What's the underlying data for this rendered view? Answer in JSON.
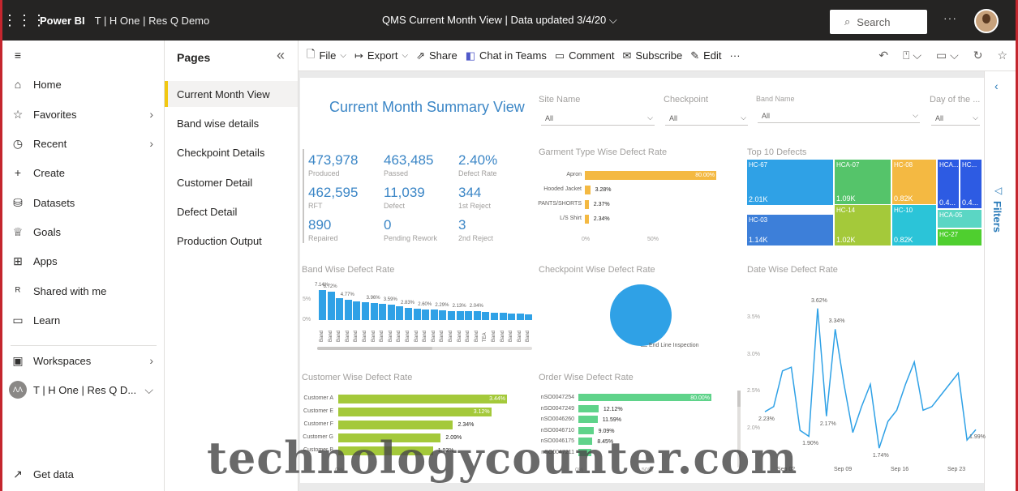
{
  "topbar": {
    "app_name": "Power BI",
    "workspace": "T | H One | Res Q Demo",
    "report_title": "QMS Current Month View  |  Data updated 3/4/20",
    "search_placeholder": "Search",
    "more": "···"
  },
  "nav": {
    "items": [
      {
        "label": "Home",
        "icon": "home-icon"
      },
      {
        "label": "Favorites",
        "icon": "star-icon"
      },
      {
        "label": "Recent",
        "icon": "clock-icon"
      },
      {
        "label": "Create",
        "icon": "plus-icon"
      },
      {
        "label": "Datasets",
        "icon": "database-icon"
      },
      {
        "label": "Goals",
        "icon": "trophy-icon"
      },
      {
        "label": "Apps",
        "icon": "apps-icon"
      },
      {
        "label": "Shared with me",
        "icon": "shared-icon"
      },
      {
        "label": "Learn",
        "icon": "book-icon"
      },
      {
        "label": "Workspaces",
        "icon": "workspaces-icon"
      },
      {
        "label": "T | H One | Res Q D...",
        "icon": "workspace-avatar-icon"
      },
      {
        "label": "Get data",
        "icon": "arrow-icon"
      }
    ]
  },
  "pages": {
    "title": "Pages",
    "items": [
      "Current Month View",
      "Band wise details",
      "Checkpoint Details",
      "Customer Detail",
      "Defect Detail",
      "Production Output"
    ]
  },
  "actionbar": {
    "file": "File",
    "export": "Export",
    "share": "Share",
    "chat": "Chat in Teams",
    "comment": "Comment",
    "subscribe": "Subscribe",
    "edit": "Edit",
    "more": "···"
  },
  "filters": {
    "label": "Filters"
  },
  "report": {
    "title": "Current Month Summary View",
    "slicers": [
      {
        "label": "Site Name",
        "value": "All"
      },
      {
        "label": "Checkpoint",
        "value": "All"
      },
      {
        "label": "Band Name",
        "value": "All"
      },
      {
        "label": "Day of the ...",
        "value": "All"
      }
    ],
    "kpis": [
      {
        "value": "473,978",
        "label": "Produced"
      },
      {
        "value": "463,485",
        "label": "Passed"
      },
      {
        "value": "2.40%",
        "label": "Defect Rate"
      },
      {
        "value": "462,595",
        "label": "RFT"
      },
      {
        "value": "11,039",
        "label": "Defect"
      },
      {
        "value": "344",
        "label": "1st Reject"
      },
      {
        "value": "890",
        "label": "Repaired"
      },
      {
        "value": "0",
        "label": "Pending Rework"
      },
      {
        "value": "3",
        "label": "2nd Reject"
      }
    ]
  },
  "chart_data": [
    {
      "type": "bar",
      "title": "Garment Type Wise Defect Rate",
      "orientation": "horizontal",
      "categories": [
        "Apron",
        "Hooded Jacket",
        "PANTS/SHORTS",
        "L/S Shirt"
      ],
      "values": [
        80.0,
        3.28,
        2.37,
        2.34
      ],
      "data_labels": [
        "80.00%",
        "3.28%",
        "2.37%",
        "2.34%"
      ],
      "x_ticks": [
        "0%",
        "50%"
      ],
      "color": "#f4b942"
    },
    {
      "type": "treemap",
      "title": "Top 10 Defects",
      "cells": [
        {
          "name": "HC-67",
          "value": "2.01K",
          "color": "#2fa1e6"
        },
        {
          "name": "HC-03",
          "value": "1.14K",
          "color": "#3d7fd9"
        },
        {
          "name": "HCA-07",
          "value": "1.09K",
          "color": "#55c46a"
        },
        {
          "name": "HC-14",
          "value": "1.02K",
          "color": "#a4c93a"
        },
        {
          "name": "HC-08",
          "value": "0.82K",
          "color": "#f4b942"
        },
        {
          "name": "HC-10",
          "value": "0.82K",
          "color": "#2bc4d8"
        },
        {
          "name": "HCA...",
          "value": "0.4...",
          "color": "#2d5be3"
        },
        {
          "name": "HC...",
          "value": "0.4...",
          "color": "#2d5be3"
        },
        {
          "name": "HCA-05",
          "value": "",
          "color": "#5bd6c4"
        },
        {
          "name": "HC-27",
          "value": "",
          "color": "#4fcf2f"
        }
      ]
    },
    {
      "type": "bar",
      "title": "Band Wise Defect Rate",
      "categories": [
        "Band",
        "Band",
        "Band",
        "Band",
        "Band",
        "Band",
        "Band",
        "Band",
        "Band",
        "Band",
        "Band",
        "Band",
        "Band",
        "Band",
        "Band",
        "Band",
        "Band",
        "Band",
        "Band",
        "TEA",
        "Band",
        "Band",
        "Band",
        "Band",
        "Band"
      ],
      "values": [
        7.14,
        6.72,
        5.2,
        4.77,
        4.5,
        4.2,
        3.96,
        3.8,
        3.59,
        3.3,
        2.83,
        2.7,
        2.6,
        2.45,
        2.29,
        2.2,
        2.13,
        2.08,
        2.04,
        1.9,
        1.8,
        1.7,
        1.6,
        1.5,
        1.4
      ],
      "data_labels": {
        "0": "7.14%",
        "1": "6.72%",
        "3": "4.77%",
        "6": "3.96%",
        "8": "3.59%",
        "10": "2.83%",
        "12": "2.60%",
        "14": "2.29%",
        "16": "2.13%",
        "18": "2.04%"
      },
      "y_ticks": [
        "5%",
        "0%"
      ],
      "ylim": [
        0,
        8
      ],
      "color": "#2fa1e6"
    },
    {
      "type": "pie",
      "title": "Checkpoint Wise Defect Rate",
      "slices": [
        {
          "name": "End Line Inspection",
          "value": 100
        }
      ],
      "color": "#2fa1e6"
    },
    {
      "type": "line",
      "title": "Date Wise Defect Rate",
      "values": [
        2.23,
        2.3,
        2.78,
        2.83,
        1.98,
        1.9,
        3.62,
        2.17,
        3.34,
        2.6,
        1.95,
        2.3,
        2.6,
        1.74,
        2.1,
        2.25,
        2.6,
        2.9,
        2.25,
        2.3,
        2.45,
        2.6,
        2.75,
        1.85,
        1.99
      ],
      "data_labels": {
        "0": "2.23%",
        "5": "1.90%",
        "6": "3.62%",
        "7": "2.17%",
        "8": "3.34%",
        "13": "1.74%",
        "24": "1.99%"
      },
      "y_ticks": [
        "3.5%",
        "3.0%",
        "2.5%",
        "2.0%"
      ],
      "x_ticks": [
        "Sep 02",
        "Sep 09",
        "Sep 16",
        "Sep 23"
      ],
      "ylim": [
        1.6,
        3.9
      ],
      "color": "#2fa1e6"
    },
    {
      "type": "bar",
      "title": "Customer Wise Defect Rate",
      "orientation": "horizontal",
      "categories": [
        "Customer A",
        "Customer E",
        "Customer F",
        "Customer G",
        "Customer B"
      ],
      "values": [
        3.44,
        3.12,
        2.34,
        2.09,
        1.93
      ],
      "data_labels": [
        "3.44%",
        "3.12%",
        "2.34%",
        "2.09%",
        "1.93%"
      ],
      "x_ticks": [
        "0%"
      ],
      "color": "#a4c93a"
    },
    {
      "type": "bar",
      "title": "Order Wise Defect Rate",
      "orientation": "horizontal",
      "categories": [
        "nSO0047254",
        "nSO0047249",
        "nSO0046260",
        "nSO0046710",
        "nSO0046175",
        "nSO0047211"
      ],
      "values": [
        80.0,
        12.12,
        11.59,
        9.09,
        8.45,
        8.0
      ],
      "data_labels": [
        "80.00%",
        "12.12%",
        "11.59%",
        "9.09%",
        "8.45%",
        ""
      ],
      "x_ticks": [
        "0%",
        "50%"
      ],
      "color": "#5fd38a"
    }
  ],
  "watermark": "technologycounter.com"
}
